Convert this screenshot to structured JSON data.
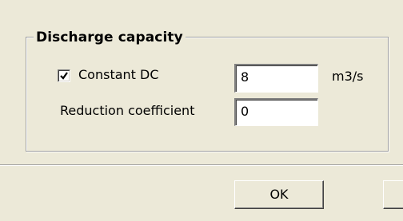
{
  "discharge": {
    "group_title": "Discharge capacity",
    "constant_dc": {
      "checked": true,
      "label": "Constant DC",
      "value": "8",
      "unit": "m3/s"
    },
    "reduction_coefficient": {
      "label": "Reduction coefficient",
      "value": "0"
    }
  },
  "buttons": {
    "ok_label": "OK",
    "second_label": ""
  }
}
